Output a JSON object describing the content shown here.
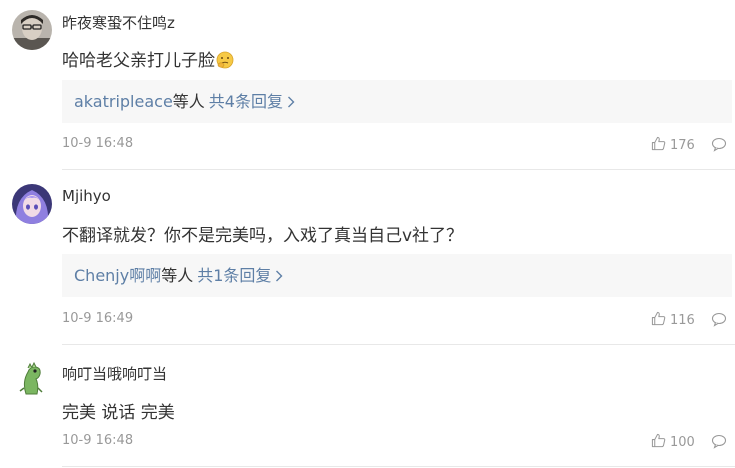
{
  "comments": [
    {
      "username": "昨夜寒蛩不住鸣z",
      "text": "哈哈老父亲打儿子脸",
      "emoji_icon": "thinking-face-emoji",
      "reply_users": "akatripleace",
      "reply_suffix": "等人",
      "reply_count": "共4条回复",
      "timestamp": "10-9 16:48",
      "likes": "176"
    },
    {
      "username": "Mjihyo",
      "text": "不翻译就发？你不是完美吗，入戏了真当自己v社了？",
      "reply_users": "Chenjy啊啊",
      "reply_suffix": "等人",
      "reply_count": "共1条回复",
      "timestamp": "10-9 16:49",
      "likes": "116"
    },
    {
      "username": "响叮当哦响叮当",
      "text": "完美 说话 完美",
      "timestamp": "10-9 16:48",
      "likes": "100"
    }
  ],
  "colors": {
    "link": "#5e7fa6",
    "meta": "#999999",
    "reply_bg": "#f7f7f7",
    "divider": "#e8e8e8"
  }
}
